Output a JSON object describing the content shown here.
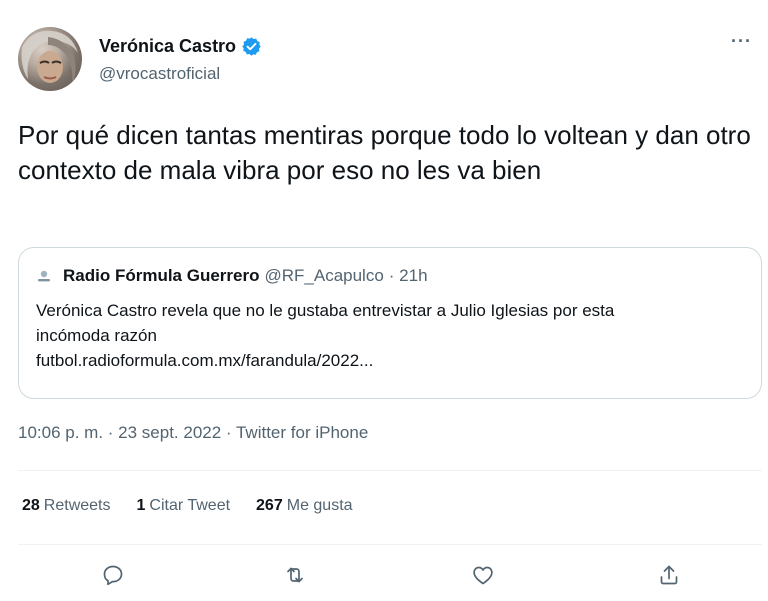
{
  "author": {
    "display_name": "Verónica Castro",
    "handle": "@vrocastroficial",
    "verified": true,
    "verified_color": "#1d9bf0"
  },
  "more_label": "···",
  "tweet": {
    "text": "Por qué dicen tantas mentiras porque todo lo voltean y dan otro contexto de mala vibra por eso no les va bien"
  },
  "quoted_tweet": {
    "author_name": "Radio Fórmula Guerrero",
    "author_handle": "@RF_Acapulco",
    "age": "· 21h",
    "text_line1": "Verónica Castro revela que no le gustaba entrevistar a Julio Iglesias por esta",
    "text_line2": "incómoda razón",
    "link": "futbol.radioformula.com.mx/farandula/2022..."
  },
  "meta": "10:06 p. m. · 23 sept. 2022 · Twitter for iPhone",
  "stats": {
    "retweets_count": "28",
    "retweets_label": "Retweets",
    "quotes_count": "1",
    "quotes_label": "Citar Tweet",
    "likes_count": "267",
    "likes_label": "Me gusta"
  },
  "actions": [
    "reply-icon",
    "retweet-icon",
    "like-icon",
    "share-icon"
  ],
  "colors": {
    "text": "#0f1419",
    "secondary": "#536471",
    "border": "#cfd9de",
    "divider": "#eff3f4"
  }
}
